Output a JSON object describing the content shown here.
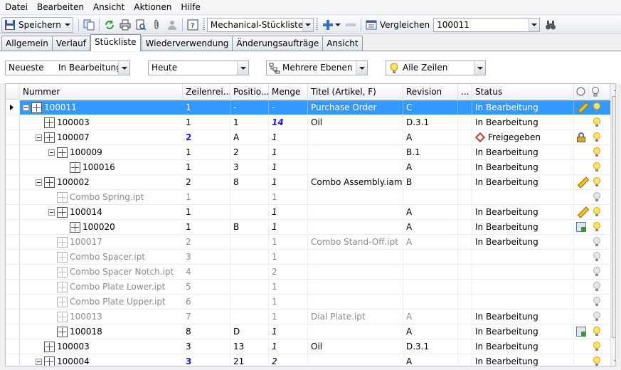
{
  "menu": [
    "Datei",
    "Bearbeiten",
    "Ansicht",
    "Aktionen",
    "Hilfe"
  ],
  "toolbar": {
    "save_label": "Speichern",
    "view_combo": "Mechanical-Stückliste",
    "compare_label": "Vergleichen",
    "compare_value": "100011"
  },
  "tabs": [
    "Allgemein",
    "Verlauf",
    "Stückliste",
    "Wiederverwendung",
    "Änderungsaufträge",
    "Ansicht"
  ],
  "active_tab": "Stückliste",
  "filters": {
    "version_left": "Neueste",
    "version_right": "In Bearbeitung",
    "date": "Heute",
    "levels": "Mehrere Ebenen",
    "rows": "Alle Zeilen"
  },
  "columns": [
    "Nummer",
    "Zeilenrei...",
    "Positio...",
    "Menge",
    "Titel (Artikel, F)",
    "Revision",
    "...",
    "Status"
  ],
  "rows": [
    {
      "nummer": "100011",
      "zeile": "1",
      "pos": "-",
      "menge": "-",
      "titel": "Purchase Order",
      "rev": "C",
      "status": "In Bearbeitung"
    },
    {
      "nummer": "100003",
      "zeile": "1",
      "pos": "1",
      "menge": "14",
      "titel": "Oil",
      "rev": "D.3.1",
      "status": "In Bearbeitung"
    },
    {
      "nummer": "100007",
      "zeile": "2",
      "pos": "A",
      "menge": "1",
      "titel": "",
      "rev": "A",
      "status": "Freigegeben"
    },
    {
      "nummer": "100009",
      "zeile": "1",
      "pos": "2",
      "menge": "1",
      "titel": "",
      "rev": "B.1",
      "status": "In Bearbeitung"
    },
    {
      "nummer": "100016",
      "zeile": "1",
      "pos": "3",
      "menge": "1",
      "titel": "",
      "rev": "A",
      "status": "In Bearbeitung"
    },
    {
      "nummer": "100002",
      "zeile": "2",
      "pos": "8",
      "menge": "1",
      "titel": "Combo Assembly.iam",
      "rev": "B",
      "status": "In Bearbeitung"
    },
    {
      "nummer": "Combo Spring.ipt",
      "zeile": "1",
      "pos": "",
      "menge": "1",
      "titel": "",
      "rev": "",
      "status": ""
    },
    {
      "nummer": "100014",
      "zeile": "1",
      "pos": "",
      "menge": "1",
      "titel": "",
      "rev": "A",
      "status": "In Bearbeitung"
    },
    {
      "nummer": "100020",
      "zeile": "1",
      "pos": "B",
      "menge": "1",
      "titel": "",
      "rev": "A",
      "status": "In Bearbeitung"
    },
    {
      "nummer": "100017",
      "zeile": "2",
      "pos": "",
      "menge": "1",
      "titel": "Combo Stand-Off.ipt",
      "rev": "A",
      "status": "In Bearbeitung"
    },
    {
      "nummer": "Combo Spacer.ipt",
      "zeile": "3",
      "pos": "",
      "menge": "1",
      "titel": "",
      "rev": "",
      "status": ""
    },
    {
      "nummer": "Combo Spacer Notch.ipt",
      "zeile": "4",
      "pos": "",
      "menge": "2",
      "titel": "",
      "rev": "",
      "status": ""
    },
    {
      "nummer": "Combo Plate Lower.ipt",
      "zeile": "5",
      "pos": "",
      "menge": "1",
      "titel": "",
      "rev": "",
      "status": ""
    },
    {
      "nummer": "Combo Plate Upper.ipt",
      "zeile": "6",
      "pos": "",
      "menge": "1",
      "titel": "",
      "rev": "",
      "status": ""
    },
    {
      "nummer": "100013",
      "zeile": "7",
      "pos": "",
      "menge": "1",
      "titel": "Dial Plate.ipt",
      "rev": "A",
      "status": "In Bearbeitung"
    },
    {
      "nummer": "100018",
      "zeile": "8",
      "pos": "D",
      "menge": "1",
      "titel": "",
      "rev": "A",
      "status": "In Bearbeitung"
    },
    {
      "nummer": "100003",
      "zeile": "3",
      "pos": "13",
      "menge": "1",
      "titel": "Oil",
      "rev": "D.3.1",
      "status": "In Bearbeitung"
    },
    {
      "nummer": "100004",
      "zeile": "3",
      "pos": "21",
      "menge": "2",
      "titel": "",
      "rev": "A",
      "status": "In Bearbeitung"
    }
  ]
}
